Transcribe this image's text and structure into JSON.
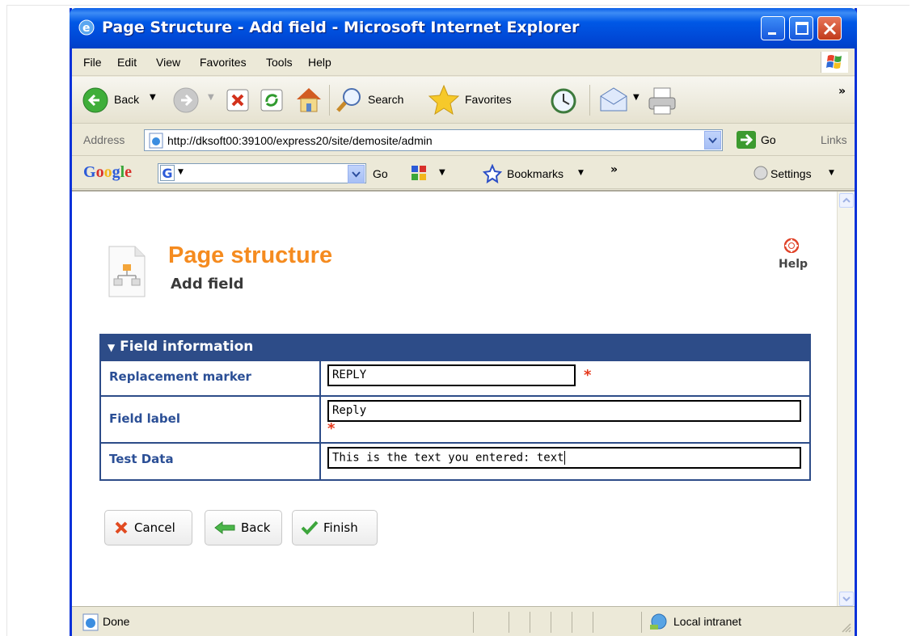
{
  "window": {
    "title": "Page Structure - Add field - Microsoft Internet Explorer"
  },
  "menubar": {
    "items": [
      "File",
      "Edit",
      "View",
      "Favorites",
      "Tools",
      "Help"
    ]
  },
  "toolbar": {
    "back_label": "Back",
    "search_label": "Search",
    "favorites_label": "Favorites",
    "overflow": "»"
  },
  "address": {
    "label": "Address",
    "url": "http://dksoft00:39100/express20/site/demosite/admin",
    "go_label": "Go",
    "links_label": "Links"
  },
  "googlebar": {
    "logo": "Google",
    "go_label": "Go",
    "bookmarks_label": "Bookmarks",
    "overflow": "»",
    "settings_label": "Settings"
  },
  "page": {
    "title": "Page structure",
    "subtitle": "Add field",
    "help_label": "Help"
  },
  "panel": {
    "header": "Field information",
    "rows": [
      {
        "label": "Replacement marker",
        "value": "REPLY",
        "required": "*"
      },
      {
        "label": "Field label",
        "value": "Reply",
        "required": "*"
      },
      {
        "label": "Test Data",
        "value": "This is the text you entered: text"
      }
    ]
  },
  "buttons": {
    "cancel": "Cancel",
    "back": "Back",
    "finish": "Finish"
  },
  "statusbar": {
    "status": "Done",
    "zone": "Local intranet"
  },
  "colors": {
    "title_accent": "#f58b1f",
    "panel_header": "#2d4c88",
    "label_text": "#2b4f96",
    "required": "#e5381b"
  }
}
